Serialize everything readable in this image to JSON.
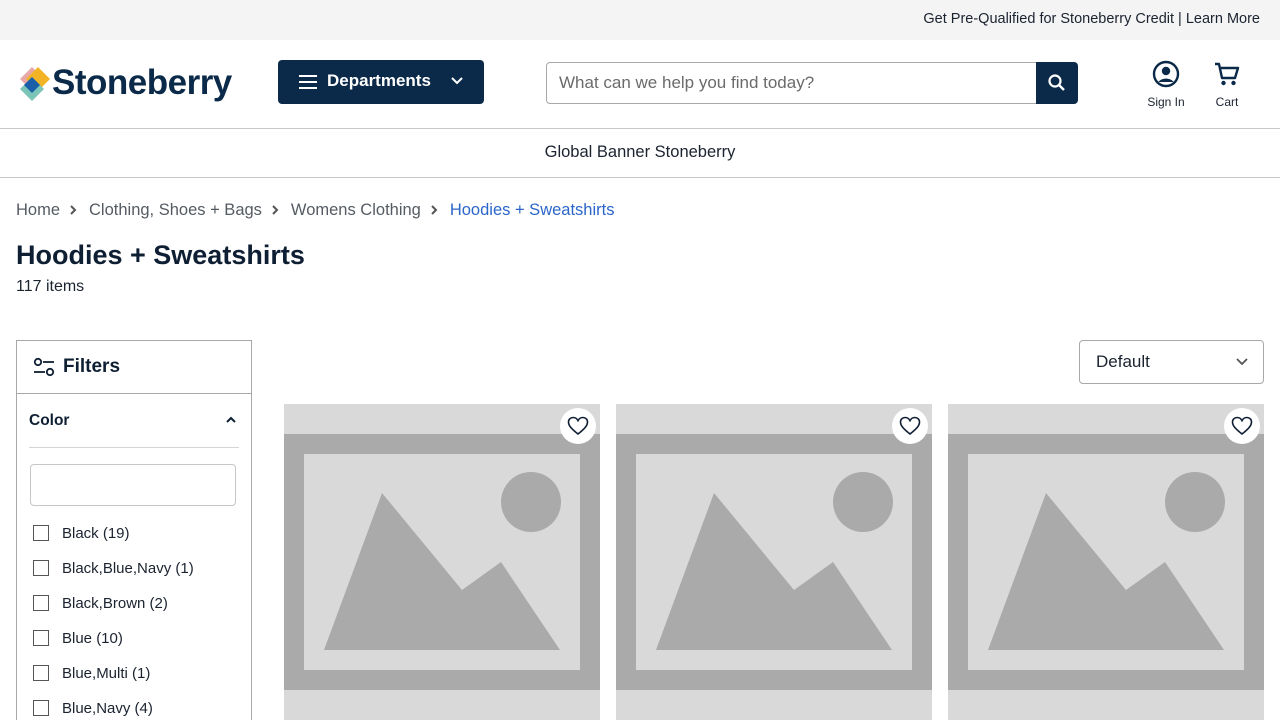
{
  "topbar": {
    "promo": "Get Pre-Qualified for Stoneberry Credit | Learn More"
  },
  "header": {
    "logo_text": "Stoneberry",
    "departments_label": "Departments",
    "search_placeholder": "What can we help you find today?",
    "sign_in_label": "Sign In",
    "cart_label": "Cart"
  },
  "banner": {
    "text": "Global Banner Stoneberry"
  },
  "breadcrumb": [
    "Home",
    "Clothing, Shoes + Bags",
    "Womens Clothing",
    "Hoodies + Sweatshirts"
  ],
  "page": {
    "title": "Hoodies + Sweatshirts",
    "item_count": "117 items"
  },
  "filters": {
    "title": "Filters",
    "color": {
      "heading": "Color",
      "search_value": "",
      "options": [
        "Black (19)",
        "Black,Blue,Navy (1)",
        "Black,Brown (2)",
        "Blue (10)",
        "Blue,Multi (1)",
        "Blue,Navy (4)"
      ]
    }
  },
  "sort": {
    "selected": "Default"
  },
  "products": [
    {
      "image": "placeholder-image-icon",
      "favorite": "heart-icon"
    },
    {
      "image": "placeholder-image-icon",
      "favorite": "heart-icon"
    },
    {
      "image": "placeholder-image-icon",
      "favorite": "heart-icon"
    }
  ],
  "colors": {
    "brand_navy": "#0b2a49",
    "link_blue": "#2b66c9",
    "placeholder_bg": "#d9d9d9",
    "placeholder_shape": "#aaaaaa"
  }
}
